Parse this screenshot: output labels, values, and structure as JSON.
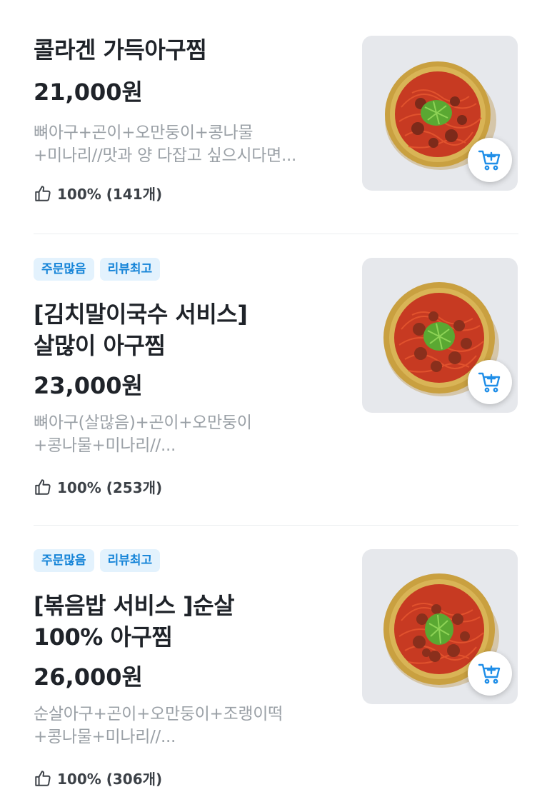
{
  "menu_items": [
    {
      "badges": [],
      "name_lines": [
        "콜라겐 가득아구찜"
      ],
      "price": "21,000원",
      "description_lines": [
        "뼈아구+곤이+오만둥이+콩나물",
        "+미나리//맛과 양 다잡고 싶으시다면..."
      ],
      "rating": "100% (141개)",
      "rating_icon": "thumbs-up-icon",
      "cart_icon": "cart-add-icon"
    },
    {
      "badges": [
        "주문많음",
        "리뷰최고"
      ],
      "name_lines": [
        "[김치말이국수 서비스]",
        "살많이 아구찜"
      ],
      "price": "23,000원",
      "description_lines": [
        "뼈아구(살많음)+곤이+오만둥이",
        "+콩나물+미나리//..."
      ],
      "rating": "100% (253개)",
      "rating_icon": "thumbs-up-icon",
      "cart_icon": "cart-add-icon"
    },
    {
      "badges": [
        "주문많음",
        "리뷰최고"
      ],
      "name_lines": [
        "[볶음밥 서비스 ]순살",
        "100% 아구찜"
      ],
      "price": "26,000원",
      "description_lines": [
        "순살아구+곤이+오만둥이+조랭이떡",
        "+콩나물+미나리//..."
      ],
      "rating": "100% (306개)",
      "rating_icon": "thumbs-up-icon",
      "cart_icon": "cart-add-icon"
    }
  ],
  "colors": {
    "accent": "#1584d8",
    "badge_bg": "#e3f2fd",
    "text_primary": "#1f2329",
    "text_secondary": "#9aa0a6",
    "divider": "#eceef0"
  }
}
